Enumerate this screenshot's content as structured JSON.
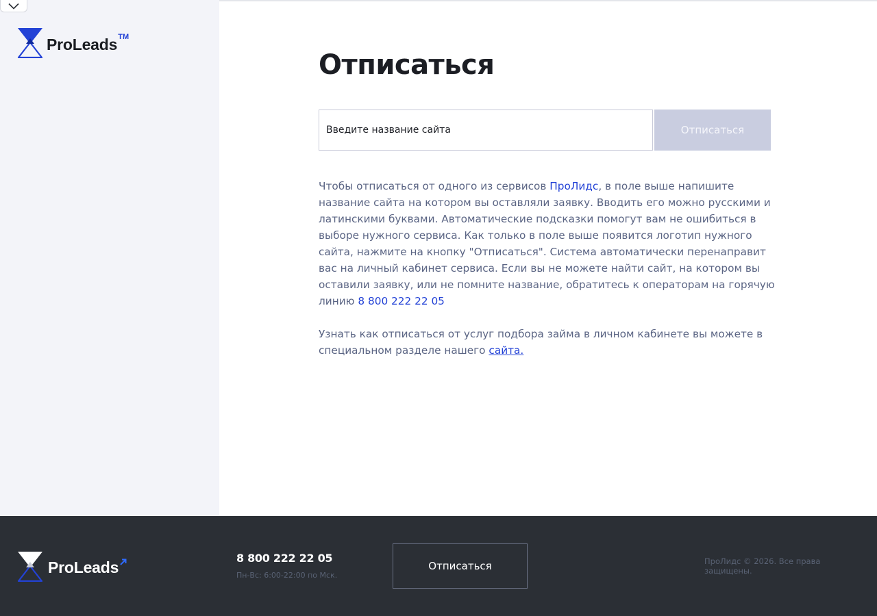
{
  "brand": {
    "name": "ProLeads",
    "trademark": "TM"
  },
  "page": {
    "title": "Отписаться"
  },
  "form": {
    "placeholder": "Введите название сайта",
    "button_label": "Отписаться"
  },
  "description": {
    "p1_before_link": "Чтобы отписаться от одного из сервисов ",
    "p1_link": "ПроЛидс",
    "p1_after_link": ", в поле выше напишите название сайта на котором вы оставляли заявку. Вводить его можно русскими и латинскими буквами. Автоматические подсказки помогут вам не ошибиться в выборе нужного сервиса. Как только в поле выше появится логотип нужного сайта, нажмите на кнопку \"Отписаться\". Система автоматически перенаправит вас на личный кабинет сервиса. Если вы не можете найти сайт, на котором вы оставили заявку, или не помните название, обратитесь к операторам на горячую линию ",
    "p1_phone": "8 800 222 22 05",
    "p2_before_link": "Узнать как отписаться от услуг подбора займа в личном кабинете вы можете в специальном разделе нашего ",
    "p2_link": "сайта."
  },
  "footer": {
    "brand_name": "ProLeads",
    "phone": "8 800 222 22 05",
    "hours": "Пн-Вс: 6:00-22:00 по Мск.",
    "button_label": "Отписаться",
    "copyright": "ПроЛидс © 2026. Все права защищены."
  },
  "colors": {
    "accent": "#2342d6",
    "sidebar_bg": "#f3f4f9",
    "footer_bg": "#2b2f35",
    "button_disabled_bg": "#c9cde0",
    "text_muted": "#5b6584"
  },
  "icons": {
    "collapse": "chevron-down-icon",
    "logo": "proleads-logo-icon",
    "footer_logo": "proleads-logo-icon",
    "footer_arrow": "arrow-up-right-icon"
  }
}
